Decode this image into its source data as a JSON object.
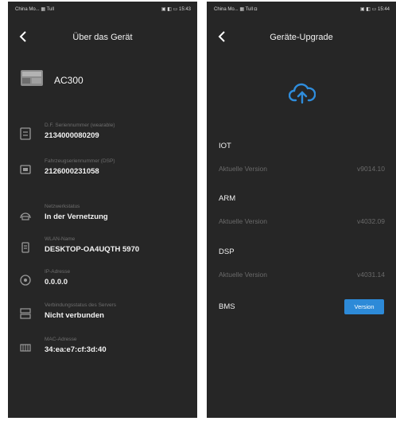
{
  "left": {
    "status": {
      "carrier": "China Mo... ▦ Tull",
      "right": "▣ ◧ ▭ 15:43"
    },
    "title": "Über das Gerät",
    "device": {
      "name": "AC300"
    },
    "rows": [
      {
        "label": "D.F. Seriennummer (wearable)",
        "value": "2134000080209",
        "icon": "device-serial-icon"
      },
      {
        "label": "Fahrzeugseriennummer (DSP)",
        "value": "2126000231058",
        "icon": "chip-icon"
      },
      {
        "label": "Netzwerkstatus",
        "value": "In der Vernetzung",
        "icon": "network-icon"
      },
      {
        "label": "WLAN-Name",
        "value": "DESKTOP-OA4UQTH 5970",
        "icon": "wifi-icon"
      },
      {
        "label": "IP-Adresse",
        "value": "0.0.0.0",
        "icon": "ip-icon"
      },
      {
        "label": "Verbindungsstatus des Servers",
        "value": "Nicht verbunden",
        "icon": "server-icon"
      },
      {
        "label": "MAC-Adresse",
        "value": "34:ea:e7:cf:3d:40",
        "icon": "mac-icon"
      }
    ]
  },
  "right": {
    "status": {
      "carrier": "China Mo... ▦ Tull ◘",
      "right": "▣ ◧ ▭ 15:44"
    },
    "title": "Geräte-Upgrade",
    "sections": [
      {
        "name": "IOT",
        "label": "Aktuelle Version",
        "version": "v9014.10"
      },
      {
        "name": "ARM",
        "label": "Aktuelle Version",
        "version": "v4032.09"
      },
      {
        "name": "DSP",
        "label": "Aktuelle Version",
        "version": "v4031.14"
      }
    ],
    "bms": {
      "name": "BMS",
      "button": "Version"
    }
  }
}
